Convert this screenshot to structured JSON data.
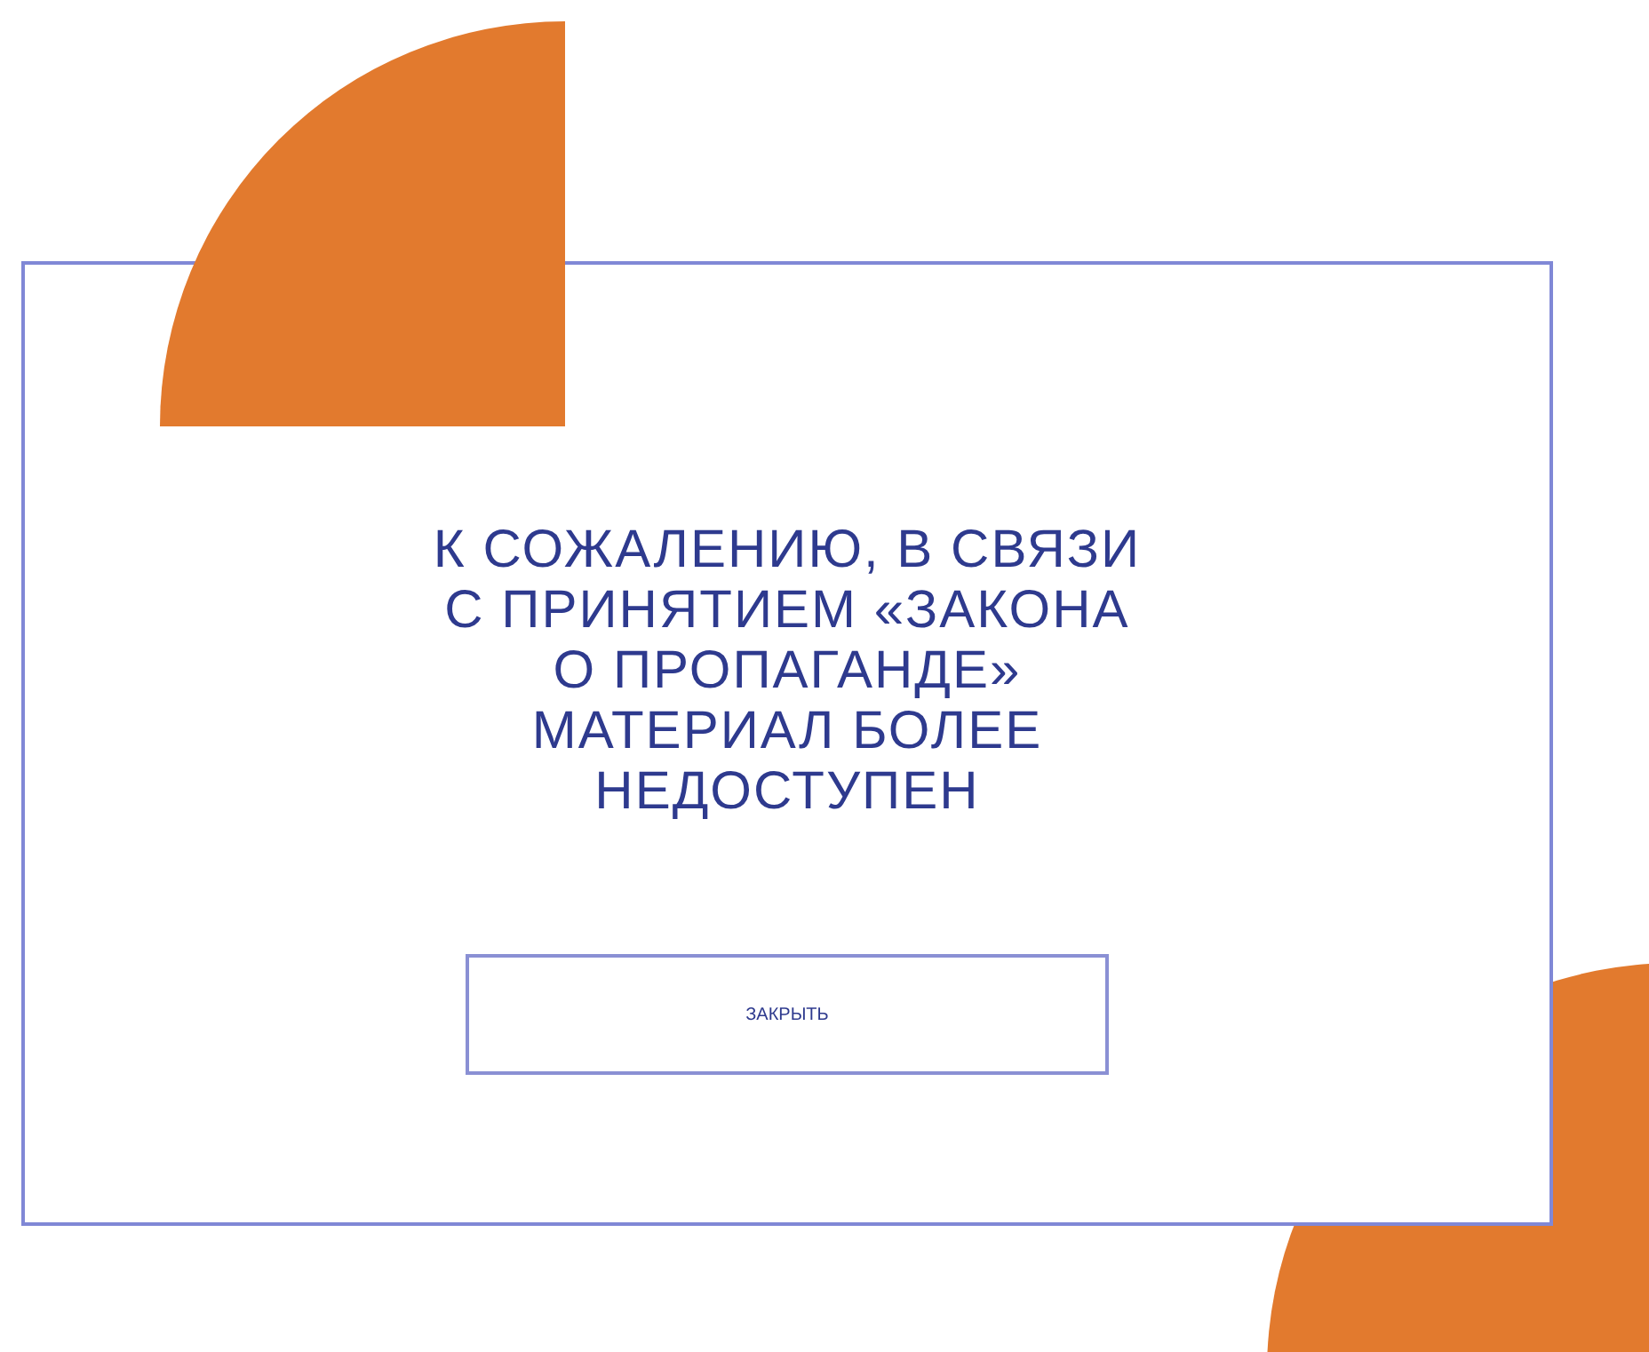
{
  "dialog": {
    "message": "К СОЖАЛЕНИЮ, В СВЯЗИ\nС ПРИНЯТИЕМ «ЗАКОНА\nО ПРОПАГАНДЕ»\nМАТЕРИАЛ БОЛЕЕ\nНЕДОСТУПЕН",
    "button": "ЗАКРЫТЬ"
  }
}
